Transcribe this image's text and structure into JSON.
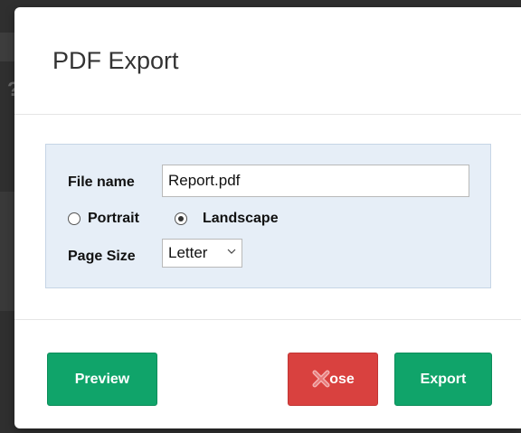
{
  "dialog": {
    "title": "PDF Export"
  },
  "form": {
    "file_name_label": "File name",
    "file_name_value": "Report.pdf",
    "orientation": {
      "options": [
        {
          "label": "Portrait",
          "checked": false
        },
        {
          "label": "Landscape",
          "checked": true
        }
      ]
    },
    "page_size_label": "Page Size",
    "page_size_value": "Letter"
  },
  "footer": {
    "preview_label": "Preview",
    "close_label": "ose",
    "export_label": "Export"
  },
  "icons": {
    "close_overlay": "close-x-icon",
    "select_chevron": "chevron-down-icon"
  },
  "colors": {
    "green_button": "#10a46a",
    "red_button": "#d9413f",
    "panel_background": "#e6eef7"
  }
}
